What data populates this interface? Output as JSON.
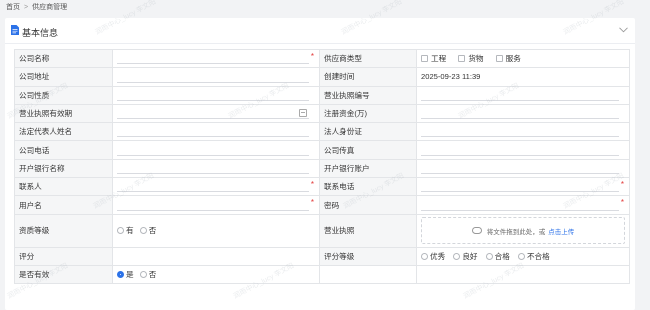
{
  "breadcrumb": {
    "home": "首页",
    "separator": ">",
    "current": "供应商管理"
  },
  "section": {
    "title": "基本信息",
    "icon": "document-icon",
    "collapse_icon": "chevron-down-icon"
  },
  "form": {
    "company_name": {
      "label": "公司名称",
      "value": ""
    },
    "supplier_type": {
      "label": "供应商类型",
      "options": [
        "工程",
        "货物",
        "服务"
      ]
    },
    "company_address": {
      "label": "公司地址",
      "value": ""
    },
    "created_time": {
      "label": "创建时间",
      "value": "2025-09-23 11:39"
    },
    "company_nature": {
      "label": "公司性质",
      "value": ""
    },
    "license_no": {
      "label": "营业执照编号",
      "value": ""
    },
    "license_validity": {
      "label": "营业执照有效期",
      "value": ""
    },
    "registered_capital": {
      "label": "注册资金(万)",
      "value": ""
    },
    "legal_rep_name": {
      "label": "法定代表人姓名",
      "value": ""
    },
    "legal_rep_id": {
      "label": "法人身份证",
      "value": ""
    },
    "company_phone": {
      "label": "公司电话",
      "value": ""
    },
    "company_fax": {
      "label": "公司传真",
      "value": ""
    },
    "bank_name": {
      "label": "开户银行名称",
      "value": ""
    },
    "bank_account": {
      "label": "开户银行账户",
      "value": ""
    },
    "contact": {
      "label": "联系人",
      "value": ""
    },
    "contact_phone": {
      "label": "联系电话",
      "value": ""
    },
    "username": {
      "label": "用户名",
      "value": ""
    },
    "password": {
      "label": "密码",
      "value": ""
    },
    "qualification": {
      "label": "资质等级",
      "options": [
        "有",
        "否"
      ]
    },
    "business_license": {
      "label": "营业执照",
      "upload_text": "将文件拖到此处，或",
      "upload_link": "点击上传"
    },
    "score": {
      "label": "评分",
      "value": ""
    },
    "score_level": {
      "label": "评分等级",
      "options": [
        "优秀",
        "良好",
        "合格",
        "不合格"
      ]
    },
    "is_valid": {
      "label": "是否有效",
      "options": [
        "是",
        "否"
      ],
      "selected": "是"
    },
    "required_mark": "*"
  },
  "watermark": "润雨中心_lucy 李文阳"
}
